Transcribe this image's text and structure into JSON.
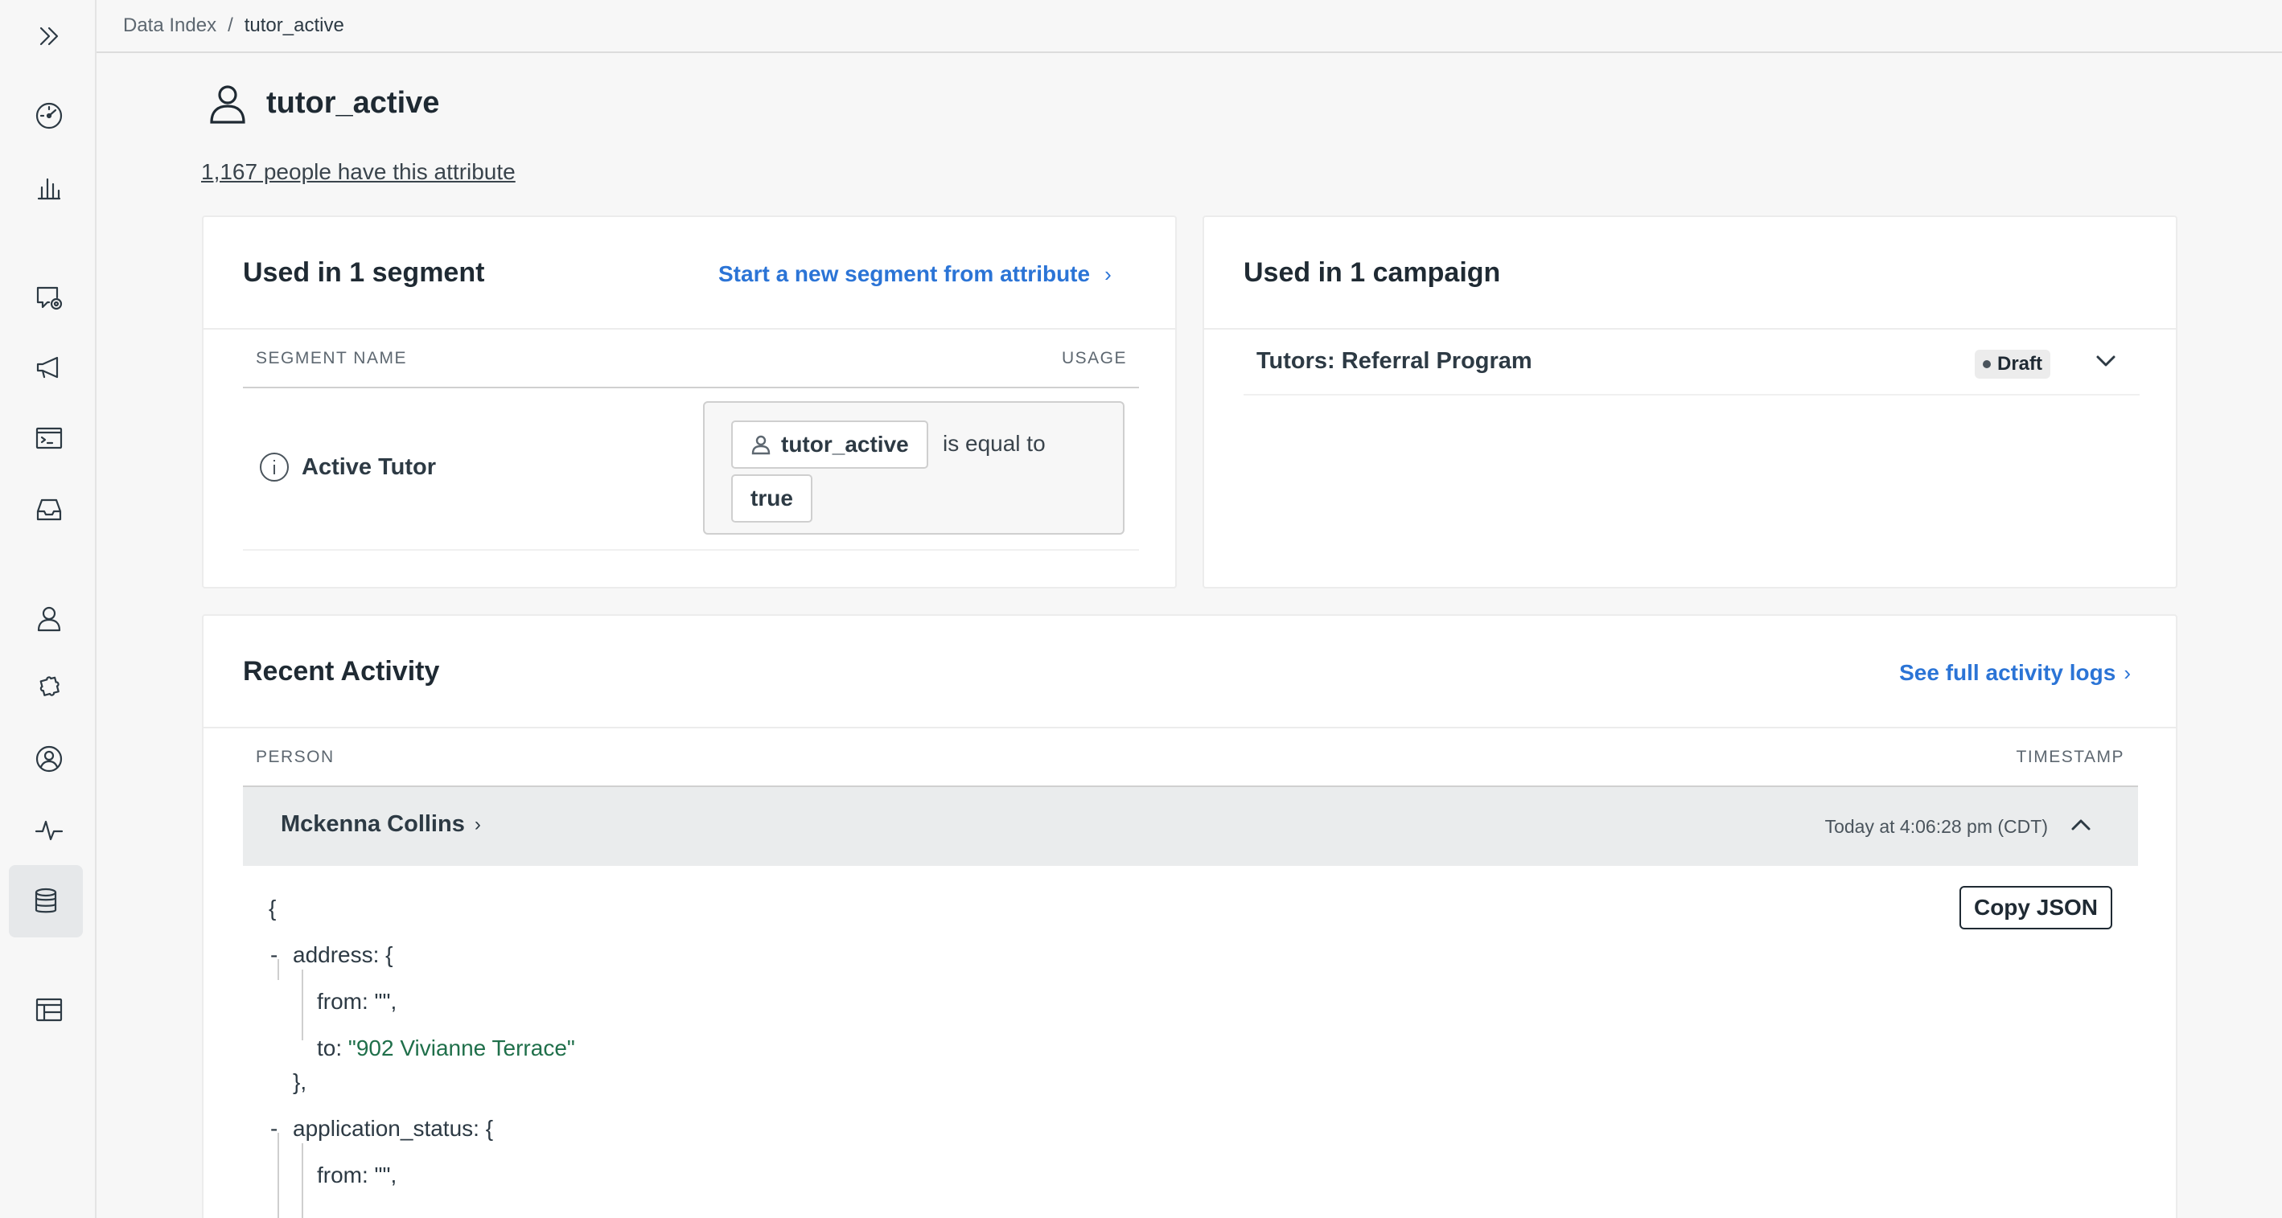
{
  "breadcrumb": {
    "parent": "Data Index",
    "separator": "/",
    "current": "tutor_active"
  },
  "attribute": {
    "name": "tutor_active",
    "people_link": "1,167 people have this attribute"
  },
  "segments_card": {
    "title": "Used in 1 segment",
    "action_link": "Start a new segment from attribute",
    "col_name": "SEGMENT NAME",
    "col_usage": "USAGE",
    "rows": [
      {
        "name": "Active Tutor",
        "attribute_chip": "tutor_active",
        "operator": "is equal to",
        "value_chip": "true"
      }
    ]
  },
  "campaigns_card": {
    "title": "Used in 1 campaign",
    "rows": [
      {
        "name": "Tutors: Referral Program",
        "status": "Draft"
      }
    ]
  },
  "activity_card": {
    "title": "Recent Activity",
    "action_link": "See full activity logs",
    "col_person": "PERSON",
    "col_timestamp": "TIMESTAMP",
    "row": {
      "person": "Mckenna Collins",
      "timestamp": "Today at 4:06:28 pm (CDT)"
    },
    "copy_button": "Copy JSON",
    "json": {
      "open_brace": "{",
      "toggle": "-",
      "address_key": "address: {",
      "address_from": "from: \"\",",
      "address_to_key": "to: ",
      "address_to_value": "\"902 Vivianne Terrace\"",
      "address_close": "},",
      "app_status_key": "application_status: {",
      "app_status_from": "from: \"\","
    }
  },
  "sidebar": {
    "icons": [
      "expand-icon",
      "dashboard-icon",
      "analytics-icon",
      "messages-icon",
      "campaigns-icon",
      "broadcasts-icon",
      "inbox-icon",
      "people-icon",
      "integrations-icon",
      "account-icon",
      "activity-icon",
      "data-index-icon",
      "objects-icon"
    ],
    "active": "data-index-icon"
  }
}
